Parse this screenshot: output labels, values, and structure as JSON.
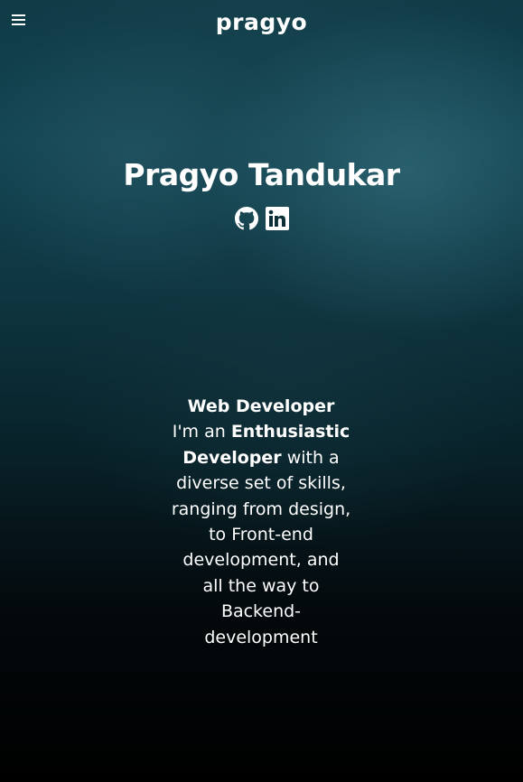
{
  "header": {
    "logo_text": "pragyo",
    "menu_icon": "hamburger-menu-icon"
  },
  "hero": {
    "name": "Pragyo Tandukar",
    "social_icons": [
      "github-icon",
      "linkedin-icon"
    ]
  },
  "about": {
    "role": "Web Developer",
    "intro_prefix": "I'm an ",
    "intro_emphasis": "Enthusiastic Developer",
    "intro_body": " with a diverse set of skills, ranging from design, to Front-end development, and all the way to Backend-development"
  },
  "colors": {
    "text": "#ffffff",
    "background_top": "#124452",
    "background_bottom": "#000000"
  }
}
